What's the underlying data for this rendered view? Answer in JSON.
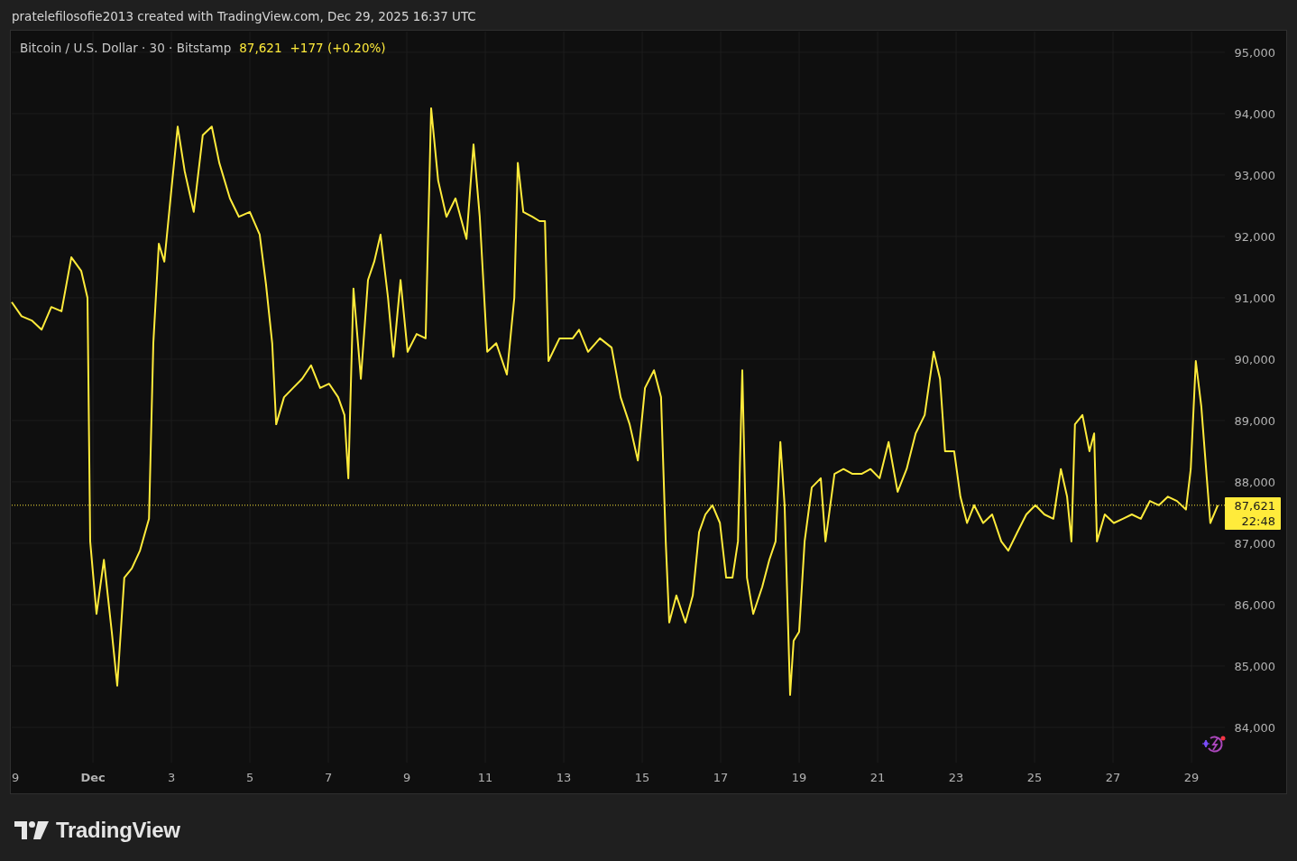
{
  "caption": "pratelefilosofie2013 created with TradingView.com, Dec 29, 2025 16:37 UTC",
  "legend": {
    "symbol": "Bitcoin / U.S. Dollar · 30 · Bitstamp",
    "price": "87,621",
    "change": "+177 (+0.20%)"
  },
  "clipped_time_label": "9",
  "price_tag": {
    "price": "87,621",
    "countdown": "22:48"
  },
  "chart_data": {
    "type": "line",
    "grid": true,
    "ref_lines": [
      {
        "axis": "y",
        "value": 87620,
        "color": "#ffeb3b"
      }
    ],
    "xlim": [
      -1.07,
      29.85
    ],
    "ylim": [
      83426,
      95338
    ],
    "xticks": [
      {
        "value": 1,
        "label": "Dec"
      },
      3,
      5,
      7,
      9,
      11,
      13,
      15,
      17,
      19,
      21,
      23,
      25,
      27,
      29
    ],
    "yticks": [
      {
        "value": 84000,
        "label": "84,000"
      },
      {
        "value": 85000,
        "label": "85,000"
      },
      {
        "value": 86000,
        "label": "86,000"
      },
      {
        "value": 87000,
        "label": "87,000"
      },
      {
        "value": 88000,
        "label": "88,000"
      },
      {
        "value": 89000,
        "label": "89,000"
      },
      {
        "value": 90000,
        "label": "90,000"
      },
      {
        "value": 91000,
        "label": "91,000"
      },
      {
        "value": 92000,
        "label": "92,000"
      },
      {
        "value": 93000,
        "label": "93,000"
      },
      {
        "value": 94000,
        "label": "94,000"
      },
      {
        "value": 95000,
        "label": "95,000"
      }
    ],
    "x": [
      -1.07,
      -0.82,
      -0.56,
      -0.31,
      -0.06,
      0.2,
      0.45,
      0.7,
      0.86,
      0.93,
      1.09,
      1.28,
      1.48,
      1.62,
      1.8,
      1.99,
      2.2,
      2.43,
      2.54,
      2.68,
      2.82,
      3.0,
      3.16,
      3.34,
      3.57,
      3.8,
      4.03,
      4.22,
      4.49,
      4.72,
      5.0,
      5.25,
      5.41,
      5.57,
      5.67,
      5.87,
      6.1,
      6.33,
      6.56,
      6.79,
      7.02,
      7.25,
      7.41,
      7.51,
      7.64,
      7.83,
      8.01,
      8.17,
      8.33,
      8.52,
      8.66,
      8.84,
      9.02,
      9.25,
      9.48,
      9.62,
      9.8,
      10.01,
      10.24,
      10.52,
      10.7,
      10.86,
      11.05,
      11.28,
      11.55,
      11.74,
      11.83,
      11.97,
      12.2,
      12.38,
      12.52,
      12.61,
      12.89,
      13.23,
      13.39,
      13.62,
      13.92,
      14.22,
      14.45,
      14.68,
      14.89,
      15.07,
      15.3,
      15.48,
      15.6,
      15.69,
      15.87,
      16.1,
      16.29,
      16.45,
      16.61,
      16.79,
      16.98,
      17.14,
      17.3,
      17.44,
      17.55,
      17.67,
      17.83,
      18.06,
      18.24,
      18.4,
      18.52,
      18.63,
      18.77,
      18.86,
      19.0,
      19.14,
      19.32,
      19.55,
      19.67,
      19.9,
      20.13,
      20.36,
      20.59,
      20.82,
      21.05,
      21.28,
      21.51,
      21.74,
      21.97,
      22.2,
      22.43,
      22.59,
      22.72,
      22.95,
      23.11,
      23.28,
      23.46,
      23.69,
      23.92,
      24.15,
      24.33,
      24.56,
      24.79,
      25.02,
      25.25,
      25.48,
      25.67,
      25.83,
      25.94,
      26.03,
      26.22,
      26.4,
      26.52,
      26.59,
      26.79,
      27.02,
      27.25,
      27.48,
      27.71,
      27.94,
      28.17,
      28.4,
      28.63,
      28.86,
      28.98,
      29.11,
      29.25,
      29.39,
      29.48,
      29.67
    ],
    "series": [
      {
        "color": "#ffeb3b",
        "values": [
          90930,
          90700,
          90630,
          90480,
          90850,
          90780,
          91660,
          91440,
          91000,
          87030,
          85850,
          86730,
          85560,
          84680,
          86440,
          86590,
          86880,
          87400,
          90260,
          91880,
          91590,
          92760,
          93790,
          93060,
          92400,
          93650,
          93790,
          93200,
          92620,
          92320,
          92400,
          92030,
          91220,
          90260,
          88940,
          89380,
          89530,
          89680,
          89900,
          89530,
          89600,
          89380,
          89090,
          88060,
          91150,
          89680,
          91290,
          91590,
          92030,
          91000,
          90040,
          91290,
          90120,
          90410,
          90340,
          94090,
          92910,
          92320,
          92620,
          91960,
          93500,
          92320,
          90120,
          90260,
          89750,
          91000,
          93200,
          92400,
          92320,
          92250,
          92250,
          89970,
          90340,
          90340,
          90480,
          90120,
          90340,
          90190,
          89380,
          88940,
          88350,
          89530,
          89820,
          89380,
          87030,
          85710,
          86150,
          85710,
          86150,
          87180,
          87470,
          87620,
          87330,
          86440,
          86440,
          87030,
          89820,
          86440,
          85850,
          86290,
          86730,
          87030,
          88650,
          87620,
          84530,
          85410,
          85560,
          87030,
          87910,
          88060,
          87030,
          88130,
          88210,
          88130,
          88130,
          88210,
          88060,
          88650,
          87840,
          88210,
          88790,
          89090,
          90120,
          89680,
          88500,
          88500,
          87760,
          87330,
          87620,
          87330,
          87470,
          87030,
          86880,
          87180,
          87470,
          87620,
          87470,
          87400,
          88210,
          87760,
          87030,
          88940,
          89090,
          88500,
          88790,
          87030,
          87470,
          87330,
          87400,
          87470,
          87400,
          87690,
          87620,
          87760,
          87690,
          87550,
          88210,
          89970,
          89230,
          88060,
          87330,
          87620
        ]
      }
    ]
  },
  "footer": {
    "brand": "TradingView"
  }
}
